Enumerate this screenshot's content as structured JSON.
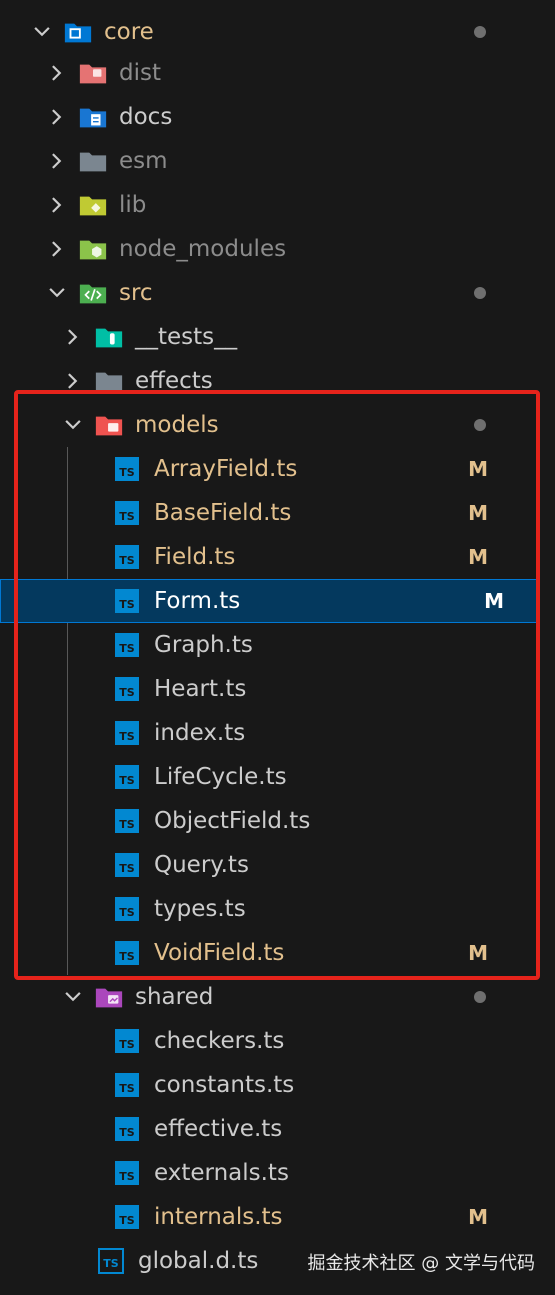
{
  "explorer": {
    "rows": [
      {
        "label": "core",
        "status": "dot",
        "type": "folder-open",
        "color": "#0078d4"
      },
      {
        "label": "dist",
        "type": "folder",
        "color": "#e57373"
      },
      {
        "label": "docs",
        "type": "folder",
        "color": "#1976d2"
      },
      {
        "label": "esm",
        "type": "folder",
        "color": "#8c8c8c"
      },
      {
        "label": "lib",
        "type": "folder",
        "color": "#c0ca33"
      },
      {
        "label": "node_modules",
        "type": "folder",
        "color": "#8bc34a"
      },
      {
        "label": "src",
        "status": "dot",
        "type": "folder-open",
        "color": "#4caf50"
      },
      {
        "label": "__tests__",
        "type": "folder",
        "color": "#00bfa5"
      },
      {
        "label": "effects",
        "type": "folder",
        "color": "#8c8c8c"
      },
      {
        "label": "models",
        "status": "dot",
        "type": "folder-open",
        "color": "#ef5350"
      },
      {
        "label": "ArrayField.ts",
        "status": "M",
        "type": "ts"
      },
      {
        "label": "BaseField.ts",
        "status": "M",
        "type": "ts"
      },
      {
        "label": "Field.ts",
        "status": "M",
        "type": "ts"
      },
      {
        "label": "Form.ts",
        "status": "M",
        "type": "ts",
        "selected": true
      },
      {
        "label": "Graph.ts",
        "type": "ts"
      },
      {
        "label": "Heart.ts",
        "type": "ts"
      },
      {
        "label": "index.ts",
        "type": "ts"
      },
      {
        "label": "LifeCycle.ts",
        "type": "ts"
      },
      {
        "label": "ObjectField.ts",
        "type": "ts"
      },
      {
        "label": "Query.ts",
        "type": "ts"
      },
      {
        "label": "types.ts",
        "type": "ts"
      },
      {
        "label": "VoidField.ts",
        "status": "M",
        "type": "ts"
      },
      {
        "label": "shared",
        "status": "dot",
        "type": "folder-open",
        "color": "#ab47bc"
      },
      {
        "label": "checkers.ts",
        "type": "ts"
      },
      {
        "label": "constants.ts",
        "type": "ts"
      },
      {
        "label": "effective.ts",
        "type": "ts"
      },
      {
        "label": "externals.ts",
        "type": "ts"
      },
      {
        "label": "internals.ts",
        "status": "M",
        "type": "ts"
      },
      {
        "label": "global.d.ts",
        "type": "ts"
      }
    ],
    "modified_marker": "M"
  },
  "watermark": "掘金技术社区 @ 文学与代码",
  "colors": {
    "background": "#181818",
    "selected_bg": "#04395e",
    "selected_border": "#0078d4",
    "modified": "#e2c08d",
    "highlight_box": "#e5231b",
    "ts_icon": "#0288d1"
  }
}
